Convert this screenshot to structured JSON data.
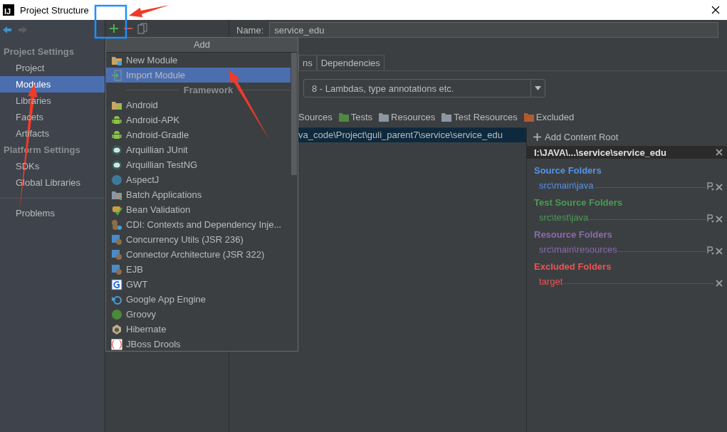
{
  "window": {
    "logo": "IJ",
    "title": "Project Structure"
  },
  "sidebar": {
    "sections": [
      {
        "heading": "Project Settings",
        "items": [
          {
            "label": "Project",
            "selected": false
          },
          {
            "label": "Modules",
            "selected": true
          },
          {
            "label": "Libraries",
            "selected": false
          },
          {
            "label": "Facets",
            "selected": false
          },
          {
            "label": "Artifacts",
            "selected": false
          }
        ]
      },
      {
        "heading": "Platform Settings",
        "items": [
          {
            "label": "SDKs",
            "selected": false
          },
          {
            "label": "Global Libraries",
            "selected": false
          }
        ]
      }
    ],
    "footer_items": [
      {
        "label": "Problems",
        "selected": false
      }
    ]
  },
  "add_popup": {
    "title": "Add",
    "items": [
      {
        "kind": "item",
        "label": "New Module",
        "selected": false
      },
      {
        "kind": "item",
        "label": "Import Module",
        "selected": true
      },
      {
        "kind": "section",
        "label": "Framework"
      },
      {
        "kind": "item",
        "label": "Android",
        "selected": false
      },
      {
        "kind": "item",
        "label": "Android-APK",
        "selected": false
      },
      {
        "kind": "item",
        "label": "Android-Gradle",
        "selected": false
      },
      {
        "kind": "item",
        "label": "Arquillian JUnit",
        "selected": false
      },
      {
        "kind": "item",
        "label": "Arquillian TestNG",
        "selected": false
      },
      {
        "kind": "item",
        "label": "AspectJ",
        "selected": false
      },
      {
        "kind": "item",
        "label": "Batch Applications",
        "selected": false
      },
      {
        "kind": "item",
        "label": "Bean Validation",
        "selected": false
      },
      {
        "kind": "item",
        "label": "CDI: Contexts and Dependency Inje...",
        "selected": false
      },
      {
        "kind": "item",
        "label": "Concurrency Utils (JSR 236)",
        "selected": false
      },
      {
        "kind": "item",
        "label": "Connector Architecture (JSR 322)",
        "selected": false
      },
      {
        "kind": "item",
        "label": "EJB",
        "selected": false
      },
      {
        "kind": "item",
        "label": "GWT",
        "selected": false
      },
      {
        "kind": "item",
        "label": "Google App Engine",
        "selected": false
      },
      {
        "kind": "item",
        "label": "Groovy",
        "selected": false
      },
      {
        "kind": "item",
        "label": "Hibernate",
        "selected": false
      },
      {
        "kind": "item",
        "label": "JBoss Drools",
        "selected": false
      }
    ]
  },
  "module": {
    "name_label": "Name:",
    "name_value": "service_edu",
    "tabs": [
      {
        "label": "ns"
      },
      {
        "label": "Dependencies"
      }
    ],
    "language_level": "8 - Lambdas, type annotations etc.",
    "mark_as": [
      {
        "label": "Sources"
      },
      {
        "label": "Tests",
        "color": "#4f8a43"
      },
      {
        "label": "Resources",
        "color": "#8c97a3"
      },
      {
        "label": "Test Resources",
        "color": "#8c97a3"
      },
      {
        "label": "Excluded",
        "color": "#b35a2f"
      }
    ],
    "content_tree": [
      {
        "label": "va_code\\Project\\guli_parent7\\service\\service_edu",
        "selected": true
      }
    ],
    "content_root": {
      "add_label": "Add Content Root",
      "path": "I:\\JAVA\\...\\service\\service_edu",
      "folder_groups": [
        {
          "title": "Source Folders",
          "color": "#5394ec",
          "entries": [
            "src\\main\\java"
          ],
          "prefix_button": true
        },
        {
          "title": "Test Source Folders",
          "color": "#499c54",
          "entries": [
            "src\\test\\java"
          ],
          "prefix_button": true
        },
        {
          "title": "Resource Folders",
          "color": "#8a6bae",
          "entries": [
            "src\\main\\resources"
          ],
          "prefix_button": true
        },
        {
          "title": "Excluded Folders",
          "color": "#ec5454",
          "entries": [
            "target"
          ],
          "prefix_button": false
        }
      ]
    }
  }
}
